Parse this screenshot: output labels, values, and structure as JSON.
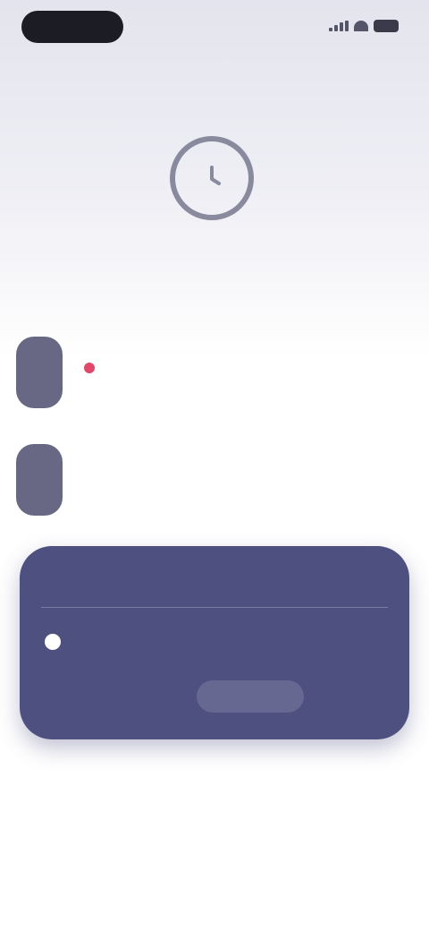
{
  "status_bar": {
    "time": "",
    "battery_color": "#3a3a4a"
  },
  "hero": {
    "icon": "clock-icon",
    "title_light": "",
    "title_strong": ""
  },
  "options": [
    {
      "avatar_text": "",
      "title": "",
      "subtitle": "",
      "badge_color": "#e0486a"
    },
    {
      "avatar_text": "",
      "title": "",
      "subtitle": ""
    }
  ],
  "card": {
    "label": "",
    "left_text": "",
    "info_text": "",
    "button_label": "",
    "background": "#4e5080"
  },
  "footer": {
    "link_label": ""
  },
  "colors": {
    "accent": "#4e5080",
    "alert": "#e0486a"
  }
}
